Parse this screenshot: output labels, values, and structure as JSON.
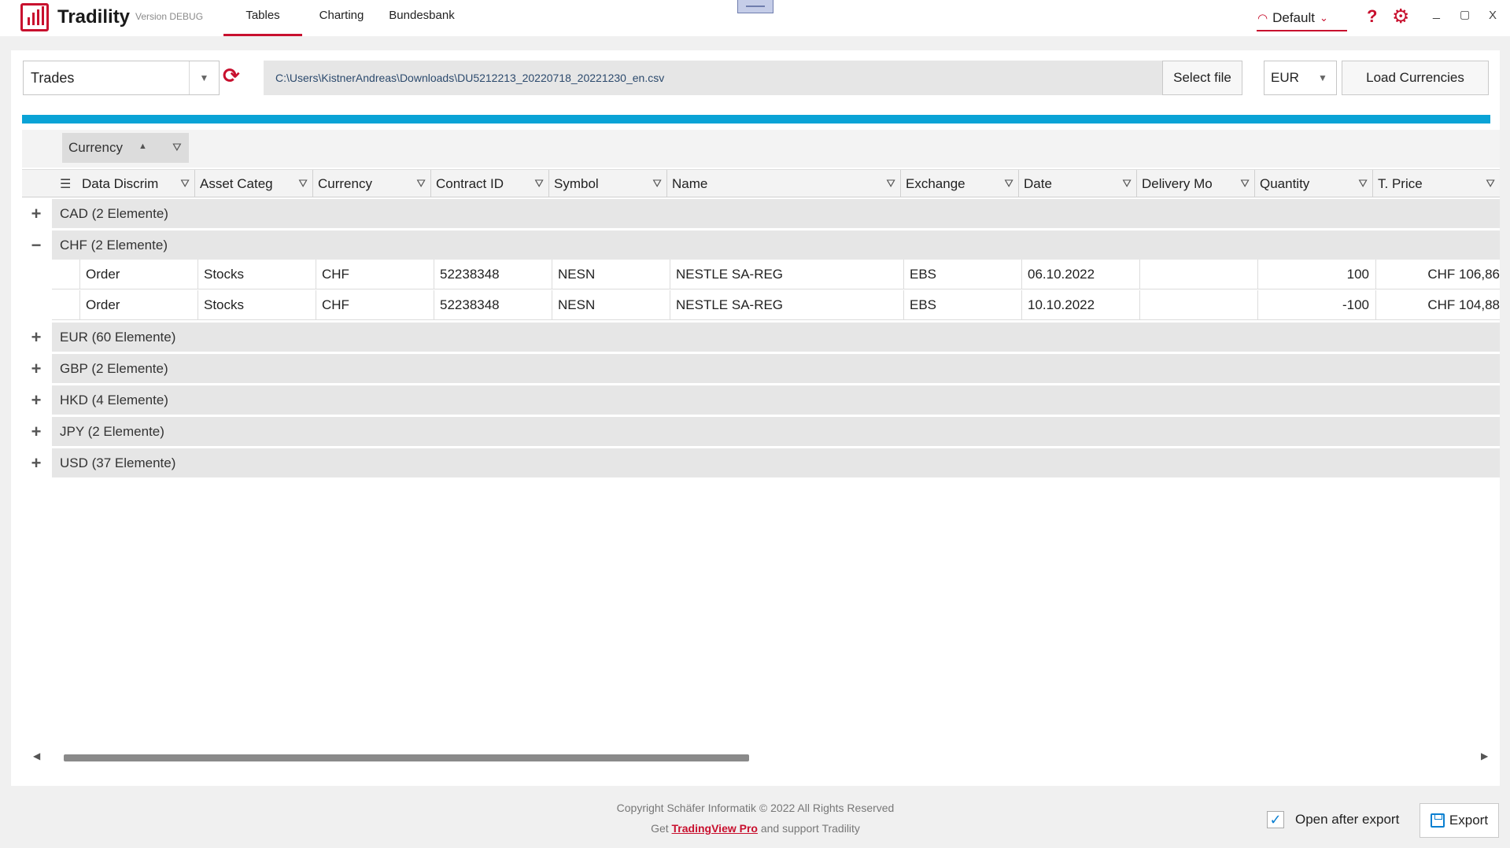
{
  "app": {
    "title": "Tradility",
    "version": "Version DEBUG",
    "nav_tabs": [
      "Tables",
      "Charting",
      "Bundesbank"
    ],
    "active_tab": "Tables",
    "profile": "Default",
    "help_icon": "?",
    "settings_icon": "⚙",
    "window_controls": [
      "_",
      "▢",
      "X"
    ]
  },
  "toolbar": {
    "table_select": "Trades",
    "file_path": "C:\\Users\\KistnerAndreas\\Downloads\\DU5212213_20220718_20221230_en.csv",
    "select_file_label": "Select file",
    "currency": "EUR",
    "load_currencies_label": "Load Currencies"
  },
  "grid": {
    "group_chip_label": "Currency",
    "columns": [
      "Data Discrim",
      "Asset Categ",
      "Currency",
      "Contract ID",
      "Symbol",
      "Name",
      "Exchange",
      "Date",
      "Delivery Mo",
      "Quantity",
      "T. Price"
    ],
    "groups": [
      {
        "label": "CAD (2 Elemente)",
        "expander": "+"
      },
      {
        "label": "CHF (2 Elemente)",
        "expander": "−"
      },
      {
        "label": "EUR (60 Elemente)",
        "expander": "+"
      },
      {
        "label": "GBP (2 Elemente)",
        "expander": "+"
      },
      {
        "label": "HKD (4 Elemente)",
        "expander": "+"
      },
      {
        "label": "JPY (2 Elemente)",
        "expander": "+"
      },
      {
        "label": "USD (37 Elemente)",
        "expander": "+"
      }
    ],
    "rows": [
      [
        "Order",
        "Stocks",
        "CHF",
        "52238348",
        "NESN",
        "NESTLE SA-REG",
        "EBS",
        "06.10.2022",
        "",
        "100",
        "CHF 106,86"
      ],
      [
        "Order",
        "Stocks",
        "CHF",
        "52238348",
        "NESN",
        "NESTLE SA-REG",
        "EBS",
        "10.10.2022",
        "",
        "-100",
        "CHF 104,88"
      ]
    ]
  },
  "footer": {
    "copyright": "Copyright Schäfer Informatik © 2022 All Rights Reserved",
    "get_text": "Get",
    "link_text": "TradingView Pro",
    "support_text": "and support Tradility",
    "open_after_export_label": "Open after export",
    "open_after_export_checked": true,
    "export_label": "Export"
  },
  "colors": {
    "accent": "#c8102e",
    "progress": "#0aa3d6"
  }
}
